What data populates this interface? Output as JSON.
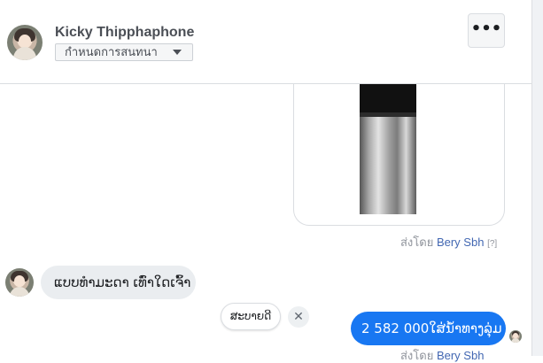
{
  "header": {
    "contact_name": "Kicky Thipphaphone",
    "conversation_settings_label": "กำหนดการสนทนา",
    "more_label": "•••"
  },
  "messages": {
    "image_sent_by_prefix": "ส่งโดย",
    "image_sent_by_name": "Bery Sbh",
    "image_sent_by_help": "[?]",
    "incoming_text": "ແບບທຳມະດາ ເທົ່າໃດເຈົ້າ",
    "outgoing_text": "2 582 000ໃສ່ນ້ຳທາງລຸ່ມ",
    "outgoing_sent_by_prefix": "ส่งโดย",
    "outgoing_sent_by_name": "Bery Sbh"
  },
  "quick_reply": {
    "label": "ສະບາຍດີ",
    "dismiss_label": "✕"
  },
  "colors": {
    "accent": "#1877f2",
    "incoming_bubble": "#eaedf0",
    "link": "#4267b2"
  },
  "icons": {
    "dropdown": "caret-down-icon",
    "more": "more-horizontal-icon",
    "dismiss": "close-icon"
  }
}
